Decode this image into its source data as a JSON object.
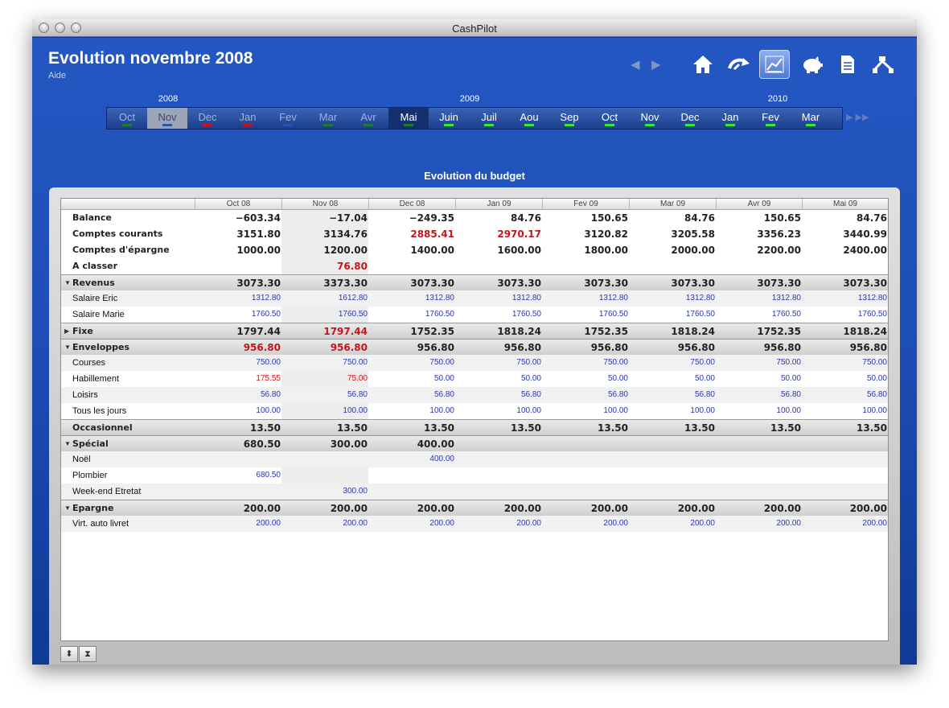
{
  "window": {
    "title": "CashPilot"
  },
  "header": {
    "title": "Evolution novembre 2008",
    "help": "Aide"
  },
  "toolbar": {
    "nav_prev": "◀",
    "nav_next": "▶",
    "buttons": [
      {
        "icon": "home-icon"
      },
      {
        "icon": "transfer-icon"
      },
      {
        "icon": "chart-icon",
        "selected": true
      },
      {
        "icon": "piggy-bank-icon"
      },
      {
        "icon": "document-icon"
      },
      {
        "icon": "network-icon"
      }
    ]
  },
  "timeline": {
    "years": [
      "2008",
      "2009",
      "2010"
    ],
    "months": [
      {
        "label": "Oct",
        "state": "past",
        "marker": "#1a7f2a"
      },
      {
        "label": "Nov",
        "state": "cur",
        "marker": "#2b53b5"
      },
      {
        "label": "Dec",
        "state": "past",
        "marker": "#c8131a"
      },
      {
        "label": "Jan",
        "state": "past",
        "marker": "#c8131a"
      },
      {
        "label": "Fev",
        "state": "past",
        "marker": "#2b53b5"
      },
      {
        "label": "Mar",
        "state": "past",
        "marker": "#1a7f2a"
      },
      {
        "label": "Avr",
        "state": "past",
        "marker": "#1a7f2a"
      },
      {
        "label": "Mai",
        "state": "fut",
        "marker": "#1a7f2a"
      },
      {
        "label": "Juin",
        "state": "norm",
        "marker": "#33ee33"
      },
      {
        "label": "Juil",
        "state": "norm",
        "marker": "#33ee33"
      },
      {
        "label": "Aou",
        "state": "norm",
        "marker": "#33ee33"
      },
      {
        "label": "Sep",
        "state": "norm",
        "marker": "#33ee33"
      },
      {
        "label": "Oct",
        "state": "norm",
        "marker": "#33ee33"
      },
      {
        "label": "Nov",
        "state": "norm",
        "marker": "#33ee33"
      },
      {
        "label": "Dec",
        "state": "norm",
        "marker": "#33ee33"
      },
      {
        "label": "Jan",
        "state": "norm",
        "marker": "#33ee33"
      },
      {
        "label": "Fev",
        "state": "norm",
        "marker": "#33ee33"
      },
      {
        "label": "Mar",
        "state": "norm",
        "marker": "#33ee33"
      }
    ],
    "scroll_next": "▶ ▶▶"
  },
  "subtitle": "Evolution du budget",
  "grid": {
    "columns": [
      "Oct 08",
      "Nov 08",
      "Dec 08",
      "Jan 09",
      "Fev 09",
      "Mar 09",
      "Avr 09",
      "Mai 09"
    ],
    "rows": [
      {
        "label": "Balance",
        "kind": "bold",
        "values": [
          "−603.34",
          "−17.04",
          "−249.35",
          "84.76",
          "150.65",
          "84.76",
          "150.65",
          "84.76"
        ],
        "red": []
      },
      {
        "label": "Comptes courants",
        "kind": "bold",
        "values": [
          "3151.80",
          "3134.76",
          "2885.41",
          "2970.17",
          "3120.82",
          "3205.58",
          "3356.23",
          "3440.99"
        ],
        "red": [
          2,
          3
        ]
      },
      {
        "label": "Comptes d'épargne",
        "kind": "bold",
        "values": [
          "1000.00",
          "1200.00",
          "1400.00",
          "1600.00",
          "1800.00",
          "2000.00",
          "2200.00",
          "2400.00"
        ],
        "red": []
      },
      {
        "label": "A classer",
        "kind": "bold",
        "values": [
          "",
          "76.80",
          "",
          "",
          "",
          "",
          "",
          ""
        ],
        "red": [
          1
        ]
      },
      {
        "label": "Revenus",
        "kind": "head",
        "triangle": "▼",
        "values": [
          "3073.30",
          "3373.30",
          "3073.30",
          "3073.30",
          "3073.30",
          "3073.30",
          "3073.30",
          "3073.30"
        ],
        "red": []
      },
      {
        "label": "Salaire Eric",
        "kind": "sub",
        "values": [
          "1312.80",
          "1612.80",
          "1312.80",
          "1312.80",
          "1312.80",
          "1312.80",
          "1312.80",
          "1312.80"
        ],
        "red": []
      },
      {
        "label": "Salaire Marie",
        "kind": "sub",
        "values": [
          "1760.50",
          "1760.50",
          "1760.50",
          "1760.50",
          "1760.50",
          "1760.50",
          "1760.50",
          "1760.50"
        ],
        "red": []
      },
      {
        "label": "Fixe",
        "kind": "head",
        "triangle": "▶",
        "values": [
          "1797.44",
          "1797.44",
          "1752.35",
          "1818.24",
          "1752.35",
          "1818.24",
          "1752.35",
          "1818.24"
        ],
        "red": [
          1
        ]
      },
      {
        "label": "Enveloppes",
        "kind": "head",
        "triangle": "▼",
        "values": [
          "956.80",
          "956.80",
          "956.80",
          "956.80",
          "956.80",
          "956.80",
          "956.80",
          "956.80"
        ],
        "red": [
          0,
          1
        ]
      },
      {
        "label": "Courses",
        "kind": "sub",
        "values": [
          "750.00",
          "750.00",
          "750.00",
          "750.00",
          "750.00",
          "750.00",
          "750.00",
          "750.00"
        ],
        "red": []
      },
      {
        "label": "Habillement",
        "kind": "sub",
        "values": [
          "175.55",
          "75.00",
          "50.00",
          "50.00",
          "50.00",
          "50.00",
          "50.00",
          "50.00"
        ],
        "red": [
          0,
          1
        ]
      },
      {
        "label": "Loisirs",
        "kind": "sub",
        "values": [
          "56.80",
          "56.80",
          "56.80",
          "56.80",
          "56.80",
          "56.80",
          "56.80",
          "56.80"
        ],
        "red": []
      },
      {
        "label": "Tous les jours",
        "kind": "sub",
        "values": [
          "100.00",
          "100.00",
          "100.00",
          "100.00",
          "100.00",
          "100.00",
          "100.00",
          "100.00"
        ],
        "red": []
      },
      {
        "label": "Occasionnel",
        "kind": "head",
        "triangle": "",
        "values": [
          "13.50",
          "13.50",
          "13.50",
          "13.50",
          "13.50",
          "13.50",
          "13.50",
          "13.50"
        ],
        "red": []
      },
      {
        "label": "Spécial",
        "kind": "head",
        "triangle": "▼",
        "values": [
          "680.50",
          "300.00",
          "400.00",
          "",
          "",
          "",
          "",
          ""
        ],
        "red": []
      },
      {
        "label": "Noël",
        "kind": "sub",
        "values": [
          "",
          "",
          "400.00",
          "",
          "",
          "",
          "",
          ""
        ],
        "red": []
      },
      {
        "label": "Plombier",
        "kind": "sub",
        "values": [
          "680.50",
          "",
          "",
          "",
          "",
          "",
          "",
          ""
        ],
        "red": []
      },
      {
        "label": "Week-end Etretat",
        "kind": "sub",
        "values": [
          "",
          "300.00",
          "",
          "",
          "",
          "",
          "",
          ""
        ],
        "red": []
      },
      {
        "label": "Epargne",
        "kind": "head",
        "triangle": "▼",
        "values": [
          "200.00",
          "200.00",
          "200.00",
          "200.00",
          "200.00",
          "200.00",
          "200.00",
          "200.00"
        ],
        "red": []
      },
      {
        "label": "Virt. auto livret",
        "kind": "sub",
        "values": [
          "200.00",
          "200.00",
          "200.00",
          "200.00",
          "200.00",
          "200.00",
          "200.00",
          "200.00"
        ],
        "red": []
      }
    ]
  },
  "footer": {
    "expand_label": "⬍",
    "collapse_label": "⧗"
  }
}
